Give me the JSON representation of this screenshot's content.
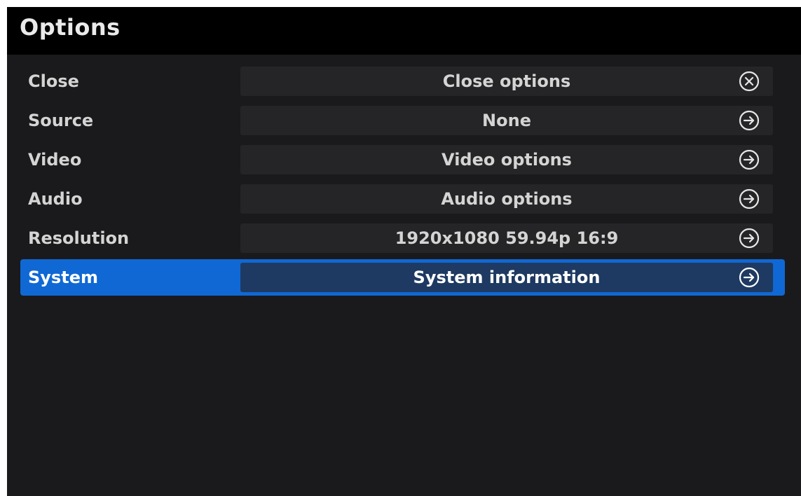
{
  "title": "Options",
  "rows": [
    {
      "label": "Close",
      "value": "Close options",
      "icon": "close-circle-icon"
    },
    {
      "label": "Source",
      "value": "None",
      "icon": "arrow-right-circle-icon"
    },
    {
      "label": "Video",
      "value": "Video options",
      "icon": "arrow-right-circle-icon"
    },
    {
      "label": "Audio",
      "value": "Audio options",
      "icon": "arrow-right-circle-icon"
    },
    {
      "label": "Resolution",
      "value": "1920x1080 59.94p 16:9",
      "icon": "arrow-right-circle-icon"
    },
    {
      "label": "System",
      "value": "System information",
      "icon": "arrow-right-circle-icon"
    }
  ],
  "selected_row": "System",
  "colors": {
    "selection": "#1068d4",
    "background": "#1a1a1c",
    "titlebar": "#000000",
    "value_box": "#252527",
    "text": "#d4d4d4"
  }
}
